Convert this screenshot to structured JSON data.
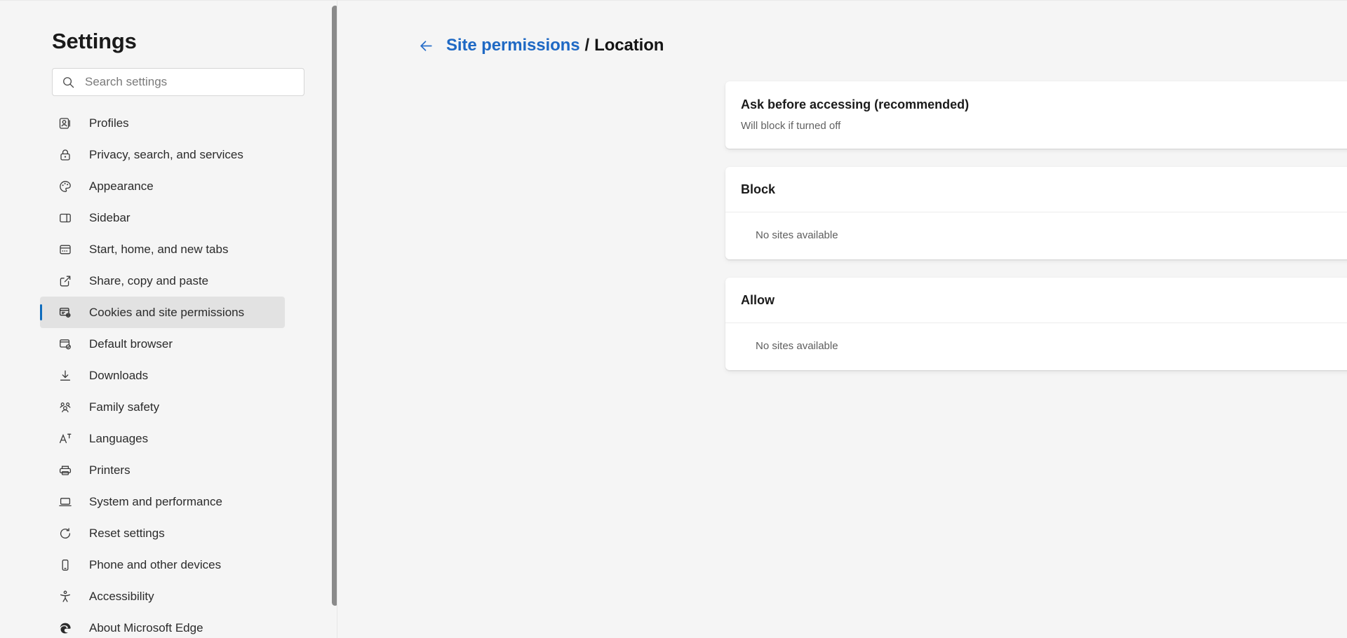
{
  "sidebar": {
    "title": "Settings",
    "search": {
      "placeholder": "Search settings",
      "value": "",
      "icon": "search-icon"
    },
    "items": [
      {
        "label": "Profiles",
        "icon": "profiles-icon",
        "selected": false
      },
      {
        "label": "Privacy, search, and services",
        "icon": "lock-icon",
        "selected": false
      },
      {
        "label": "Appearance",
        "icon": "palette-icon",
        "selected": false
      },
      {
        "label": "Sidebar",
        "icon": "sidebar-icon",
        "selected": false
      },
      {
        "label": "Start, home, and new tabs",
        "icon": "window-icon",
        "selected": false
      },
      {
        "label": "Share, copy and paste",
        "icon": "share-icon",
        "selected": false
      },
      {
        "label": "Cookies and site permissions",
        "icon": "cookies-gear-icon",
        "selected": true
      },
      {
        "label": "Default browser",
        "icon": "default-browser-icon",
        "selected": false
      },
      {
        "label": "Downloads",
        "icon": "download-icon",
        "selected": false
      },
      {
        "label": "Family safety",
        "icon": "family-icon",
        "selected": false
      },
      {
        "label": "Languages",
        "icon": "languages-icon",
        "selected": false
      },
      {
        "label": "Printers",
        "icon": "printer-icon",
        "selected": false
      },
      {
        "label": "System and performance",
        "icon": "laptop-icon",
        "selected": false
      },
      {
        "label": "Reset settings",
        "icon": "reset-icon",
        "selected": false
      },
      {
        "label": "Phone and other devices",
        "icon": "phone-icon",
        "selected": false
      },
      {
        "label": "Accessibility",
        "icon": "accessibility-icon",
        "selected": false
      },
      {
        "label": "About Microsoft Edge",
        "icon": "edge-icon",
        "selected": false
      }
    ]
  },
  "breadcrumb": {
    "back_icon": "arrow-left-icon",
    "parent": "Site permissions",
    "separator": "/",
    "current": "Location"
  },
  "main": {
    "ask": {
      "title": "Ask before accessing (recommended)",
      "subtitle": "Will block if turned off",
      "toggle_on": true
    },
    "block": {
      "header": "Block",
      "empty": "No sites available"
    },
    "allow": {
      "header": "Allow",
      "empty": "No sites available"
    }
  },
  "colors": {
    "accent": "#0f6cbd",
    "link": "#1f69c4",
    "page_bg": "#f5f5f5",
    "card_bg": "#ffffff",
    "selected_bg": "#e2e2e2"
  }
}
